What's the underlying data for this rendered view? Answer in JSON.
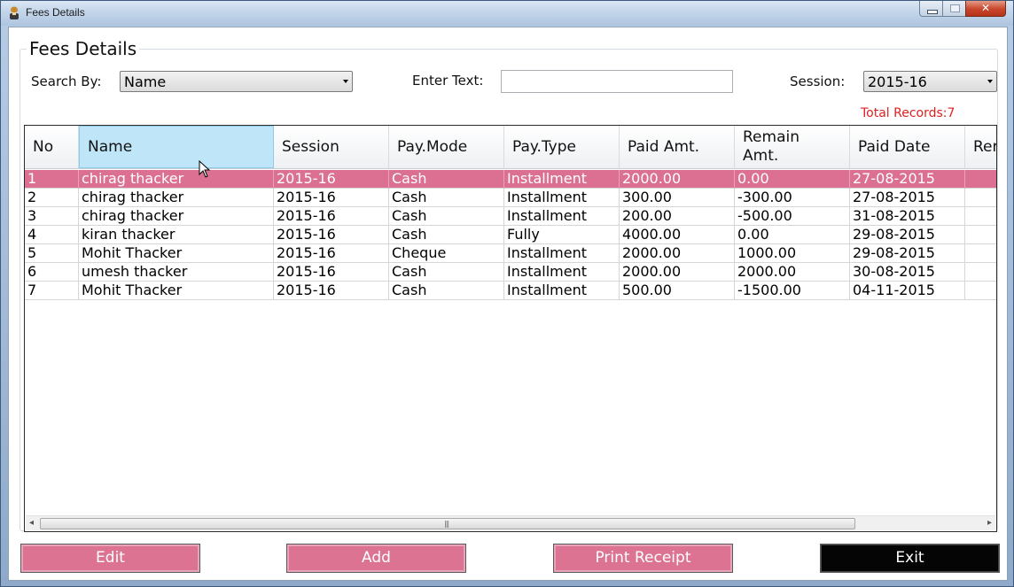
{
  "window": {
    "title": "Fees Details"
  },
  "group": {
    "title": "Fees Details"
  },
  "filters": {
    "search_by_label": "Search By:",
    "search_by_value": "Name",
    "enter_text_label": "Enter Text:",
    "enter_text_value": "",
    "session_label": "Session:",
    "session_value": "2015-16"
  },
  "total_records": "Total Records:7",
  "grid": {
    "columns": [
      "No",
      "Name",
      "Session",
      "Pay.Mode",
      "Pay.Type",
      "Paid Amt.",
      "Remain Amt.",
      "Paid Date",
      "Rer"
    ],
    "rows": [
      [
        "1",
        "chirag thacker",
        "2015-16",
        "Cash",
        "Installment",
        "2000.00",
        "0.00",
        "27-08-2015",
        ""
      ],
      [
        "2",
        "chirag thacker",
        "2015-16",
        "Cash",
        "Installment",
        "300.00",
        "-300.00",
        "27-08-2015",
        ""
      ],
      [
        "3",
        "chirag thacker",
        "2015-16",
        "Cash",
        "Installment",
        "200.00",
        "-500.00",
        "31-08-2015",
        ""
      ],
      [
        "4",
        "kiran thacker",
        "2015-16",
        "Cash",
        "Fully",
        "4000.00",
        "0.00",
        "29-08-2015",
        ""
      ],
      [
        "5",
        "Mohit Thacker",
        "2015-16",
        "Cheque",
        "Installment",
        "2000.00",
        "1000.00",
        "29-08-2015",
        ""
      ],
      [
        "6",
        "umesh thacker",
        "2015-16",
        "Cash",
        "Installment",
        "2000.00",
        "2000.00",
        "30-08-2015",
        ""
      ],
      [
        "7",
        "Mohit Thacker",
        "2015-16",
        "Cash",
        "Installment",
        "500.00",
        "-1500.00",
        "04-11-2015",
        ""
      ]
    ],
    "selected_row": 0,
    "selected_header": 1
  },
  "buttons": {
    "edit": "Edit",
    "add": "Add",
    "print_receipt": "Print Receipt",
    "exit": "Exit"
  },
  "colors": {
    "selection": "#db7093",
    "button": "#dc7393",
    "exit_button": "#050505",
    "total_records": "#e02020"
  }
}
